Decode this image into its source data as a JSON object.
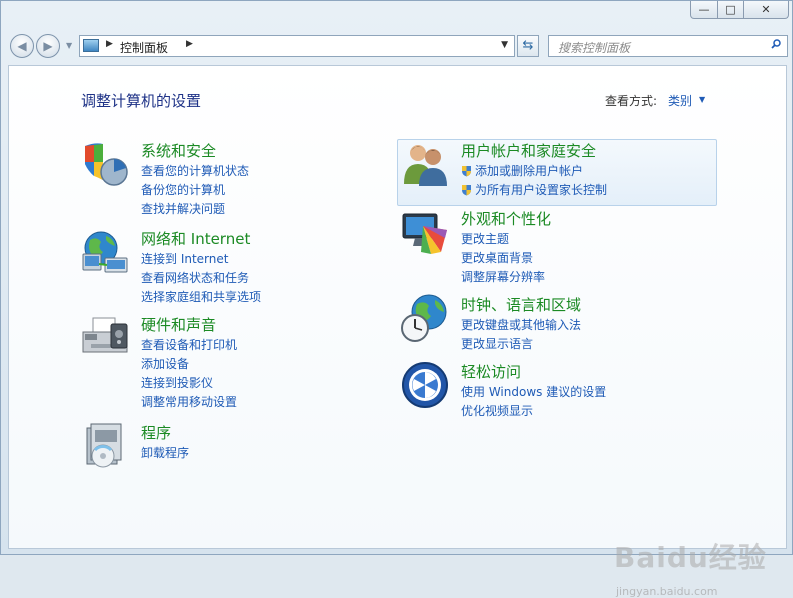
{
  "window": {
    "controls": {
      "minimize": "—",
      "maximize": "□",
      "close": "✕"
    }
  },
  "nav": {
    "back": "◀",
    "forward": "▶",
    "breadcrumb": "控制面板",
    "search_placeholder": "搜索控制面板"
  },
  "header": {
    "title": "调整计算机的设置",
    "view_label": "查看方式:",
    "view_value": "类别"
  },
  "categories": [
    {
      "title": "系统和安全",
      "links": [
        "查看您的计算机状态",
        "备份您的计算机",
        "查找并解决问题"
      ]
    },
    {
      "title": "网络和 Internet",
      "links": [
        "连接到 Internet",
        "查看网络状态和任务",
        "选择家庭组和共享选项"
      ]
    },
    {
      "title": "硬件和声音",
      "links": [
        "查看设备和打印机",
        "添加设备",
        "连接到投影仪",
        "调整常用移动设置"
      ]
    },
    {
      "title": "程序",
      "links": [
        "卸载程序"
      ]
    },
    {
      "title": "用户帐户和家庭安全",
      "links": [
        "添加或删除用户帐户",
        "为所有用户设置家长控制"
      ]
    },
    {
      "title": "外观和个性化",
      "links": [
        "更改主题",
        "更改桌面背景",
        "调整屏幕分辨率"
      ]
    },
    {
      "title": "时钟、语言和区域",
      "links": [
        "更改键盘或其他输入法",
        "更改显示语言"
      ]
    },
    {
      "title": "轻松访问",
      "links": [
        "使用 Windows 建议的设置",
        "优化视频显示"
      ]
    }
  ],
  "watermark": {
    "brand": "Baidu经验",
    "url": "jingyan.baidu.com"
  },
  "colors": {
    "title_green": "#1b8a24",
    "link_blue": "#1f5bb6",
    "header_blue": "#1e3287"
  }
}
